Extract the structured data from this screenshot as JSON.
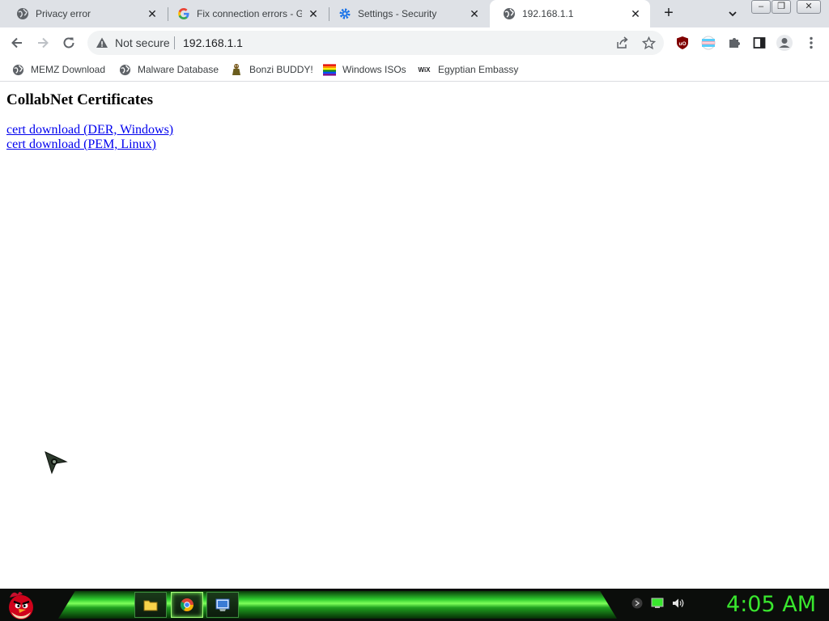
{
  "browser": {
    "tabs": [
      {
        "title": "Privacy error",
        "icon": "globe-icon",
        "active": false
      },
      {
        "title": "Fix connection errors - Go",
        "icon": "google-icon",
        "active": false
      },
      {
        "title": "Settings - Security",
        "icon": "gear-icon",
        "active": false
      },
      {
        "title": "192.168.1.1",
        "icon": "globe-icon",
        "active": true
      }
    ],
    "new_tab_label": "+",
    "window_controls": {
      "minimize": "–",
      "restore": "❐",
      "close": "✕"
    },
    "address_bar": {
      "security_label": "Not secure",
      "url": "192.168.1.1"
    },
    "bookmarks": [
      {
        "label": "MEMZ Download",
        "icon": "globe-icon"
      },
      {
        "label": "Malware Database",
        "icon": "globe-icon"
      },
      {
        "label": "Bonzi BUDDY!",
        "icon": "bonzi-icon"
      },
      {
        "label": "Windows ISOs",
        "icon": "rainbow-flag-icon"
      },
      {
        "label": "Egyptian Embassy",
        "icon": "wix-icon"
      }
    ],
    "wix_glyph": "WiX"
  },
  "page": {
    "heading": "CollabNet Certificates",
    "links": [
      {
        "label": "cert download (DER, Windows)"
      },
      {
        "label": "cert download (PEM, Linux)"
      }
    ]
  },
  "taskbar": {
    "clock": "4:05 AM",
    "pinned": [
      {
        "name": "file-explorer-icon"
      },
      {
        "name": "chrome-icon"
      },
      {
        "name": "control-panel-icon"
      }
    ],
    "tray": [
      "keyboard-icon",
      "network-icon",
      "volume-icon"
    ]
  },
  "colors": {
    "link": "#0000ee",
    "clock": "#39e62e",
    "taskbar_accent": "#2ecc2e",
    "tabstrip": "#dee1e6"
  }
}
